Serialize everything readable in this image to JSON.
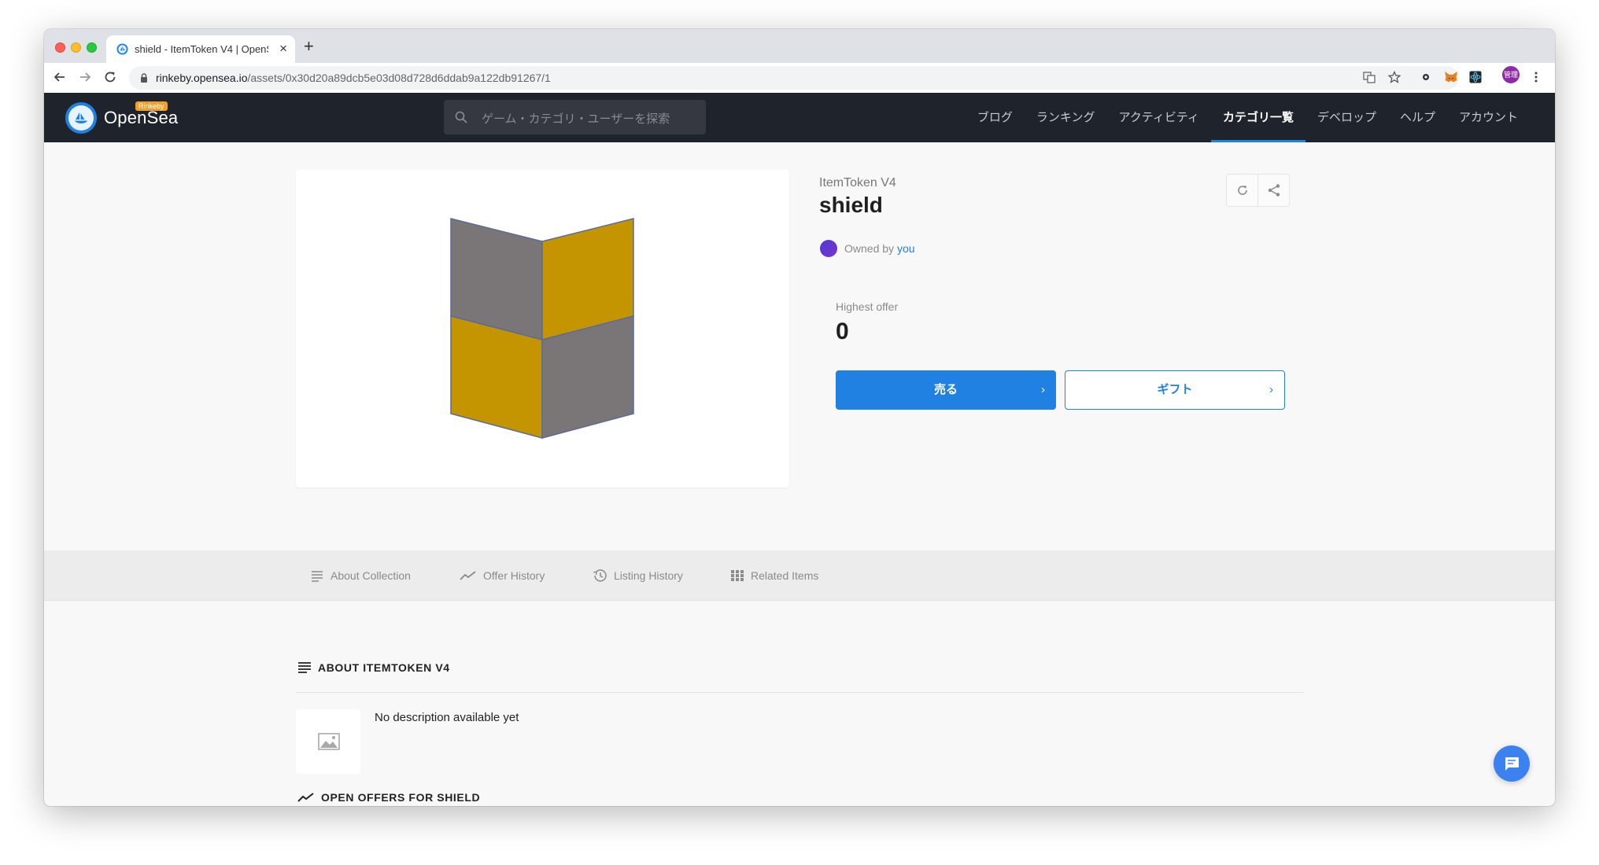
{
  "browser": {
    "tab_title": "shield - ItemToken V4 | OpenS",
    "tab_close_glyph": "×",
    "new_tab_glyph": "+",
    "url_host": "rinkeby.opensea.io",
    "url_path": "/assets/0x30d20a89dcb5e03d08d728d6ddab9a122db91267/1",
    "profile_label": "管理"
  },
  "nav": {
    "logo_text": "OpenSea",
    "network_badge": "Rinkeby",
    "search_placeholder": "ゲーム・カテゴリ・ユーザーを探索",
    "items": [
      {
        "label": "ブログ",
        "active": false
      },
      {
        "label": "ランキング",
        "active": false
      },
      {
        "label": "アクティビティ",
        "active": false
      },
      {
        "label": "カテゴリ一覧",
        "active": true
      },
      {
        "label": "デベロップ",
        "active": false
      },
      {
        "label": "ヘルプ",
        "active": false
      },
      {
        "label": "アカウント",
        "active": false
      }
    ]
  },
  "asset": {
    "collection": "ItemToken V4",
    "name": "shield",
    "owned_by_prefix": "Owned by",
    "owner": "you",
    "highest_offer_label": "Highest offer",
    "highest_offer_value": "0",
    "sell_label": "売る",
    "gift_label": "ギフト",
    "chevron_glyph": "›",
    "image_colors": {
      "gray": "#7a7576",
      "gold": "#c49500",
      "outline": "#5b6c9a"
    }
  },
  "section_tabs": [
    {
      "label": "About Collection",
      "icon": "list-icon"
    },
    {
      "label": "Offer History",
      "icon": "trend-icon"
    },
    {
      "label": "Listing History",
      "icon": "history-icon"
    },
    {
      "label": "Related Items",
      "icon": "grid-icon"
    }
  ],
  "about": {
    "heading": "ABOUT ITEMTOKEN V4",
    "description": "No description available yet"
  },
  "offers": {
    "heading": "OPEN OFFERS FOR SHIELD"
  },
  "colors": {
    "accent": "#2081e2",
    "nav_bg": "#1f232b"
  }
}
